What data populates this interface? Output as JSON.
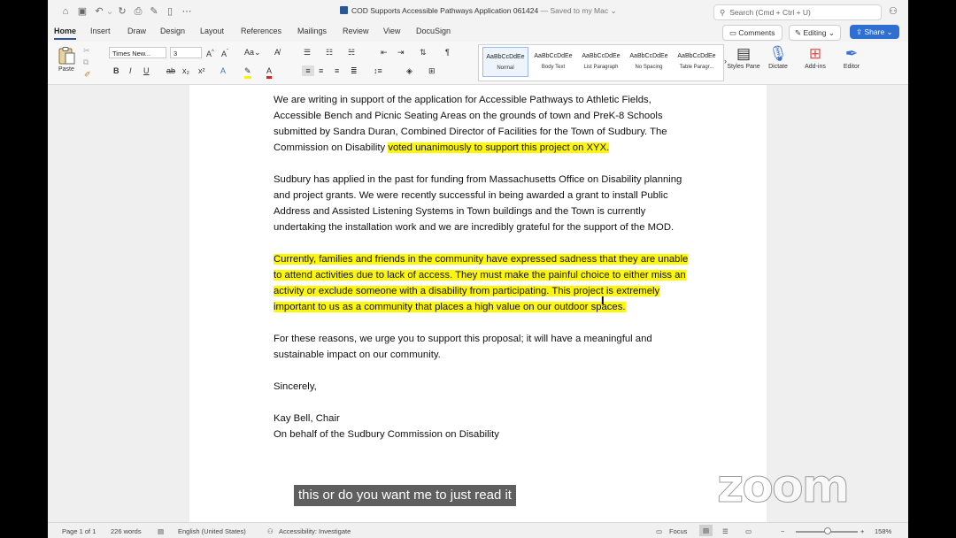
{
  "window": {
    "title": "COD Supports Accessible Pathways Application 061424",
    "save_status": "— Saved to my Mac",
    "search_placeholder": "Search (Cmd + Ctrl + U)"
  },
  "tabs": [
    "Home",
    "Insert",
    "Draw",
    "Design",
    "Layout",
    "References",
    "Mailings",
    "Review",
    "View",
    "DocuSign"
  ],
  "header_buttons": {
    "comments": "Comments",
    "editing": "Editing",
    "share": "Share"
  },
  "ribbon": {
    "paste_label": "Paste",
    "font_name": "Times New...",
    "font_size": "3",
    "styles": [
      {
        "sample": "AaBbCcDdEe",
        "name": "Normal"
      },
      {
        "sample": "AaBbCcDdEe",
        "name": "Body Text"
      },
      {
        "sample": "AaBbCcDdEe",
        "name": "List Paragraph"
      },
      {
        "sample": "AaBbCcDdEe",
        "name": "No Spacing"
      },
      {
        "sample": "AaBbCcDdEe",
        "name": "Table Paragr..."
      }
    ],
    "styles_pane_label": "Styles Pane",
    "dictate_label": "Dictate",
    "addins_label": "Add-ins",
    "editor_label": "Editor"
  },
  "document": {
    "p1_a": "We are writing in support of the application for Accessible Pathways to Athletic Fields, Accessible Bench and Picnic Seating Areas on the grounds of town and PreK-8 Schools submitted by Sandra Duran, Combined Director of Facilities for the Town of Sudbury. The Commission on Disability ",
    "p1_b": "voted unanimously to support this project on XYX.",
    "p2": "Sudbury has applied in the past for funding from Massachusetts Office on Disability planning and project grants. We were recently successful in being awarded a grant to install Public Address and Assisted Listening Systems in Town buildings and the Town is currently undertaking the installation work and we are incredibly grateful for the support of the MOD.",
    "p3": "Currently, families and friends in the community have expressed sadness that they are unable to attend activities due to lack of access. They must make the painful choice to either miss an activity or exclude someone with a disability from participating. This project is extremely important to us as a community that places a high value on our outdoor spaces.",
    "p4": "For these reasons, we urge you to support this proposal; it will have a meaningful and sustainable impact on our community.",
    "closing": "Sincerely,",
    "signer": "Kay Bell, Chair",
    "signer_org": "On behalf of the Sudbury Commission on Disability"
  },
  "caption": "this or do you want me to just read it",
  "watermark": "zoom",
  "status": {
    "page": "Page 1 of 1",
    "words": "226 words",
    "language": "English (United States)",
    "accessibility": "Accessibility: Investigate",
    "focus": "Focus",
    "zoom": "158%"
  }
}
